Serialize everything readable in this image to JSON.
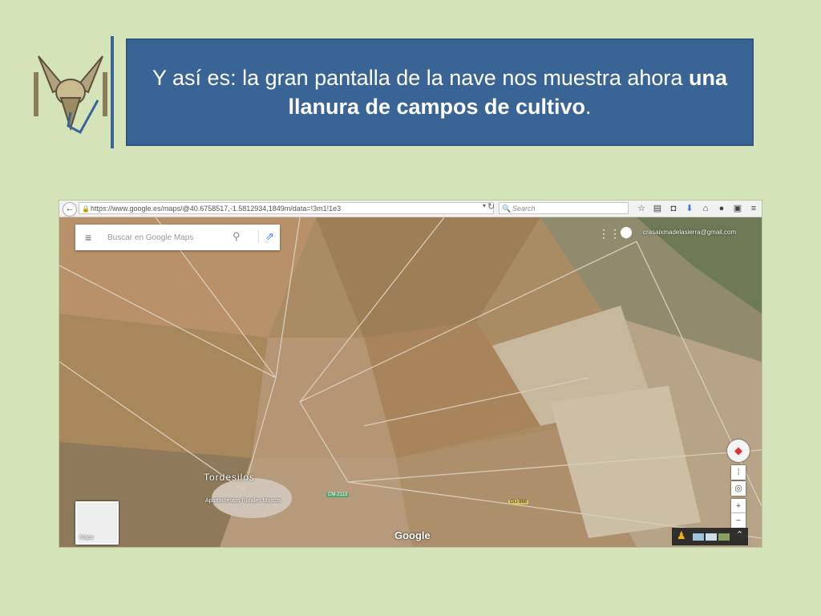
{
  "slide": {
    "title_normal_1": "Y así es: la gran pantalla de la nave nos muestra ahora ",
    "title_bold": "una llanura de campos de cultivo",
    "title_normal_2": "."
  },
  "browser": {
    "url": "https://www.google.es/maps/@40.6758517,-1.5812934,1849m/data=!3m1!1e3",
    "search_placeholder": "Search"
  },
  "map": {
    "search_placeholder": "Buscar en Google Maps",
    "account_email": "crasaixmadelasierra@gmail.com",
    "town_label": "Tordesilos",
    "poi_label": "Apartamentos Rurales Marcos",
    "road_label_1": "CM-2113",
    "road_label_2": "GU-968",
    "thumbnail_label": "Mapa",
    "brand": "Google",
    "colors": {
      "title_bg": "#3a6496",
      "slide_bg": "#d5e3b8",
      "road_cm": "#5aa06e",
      "road_gu": "#d8c25a"
    }
  }
}
